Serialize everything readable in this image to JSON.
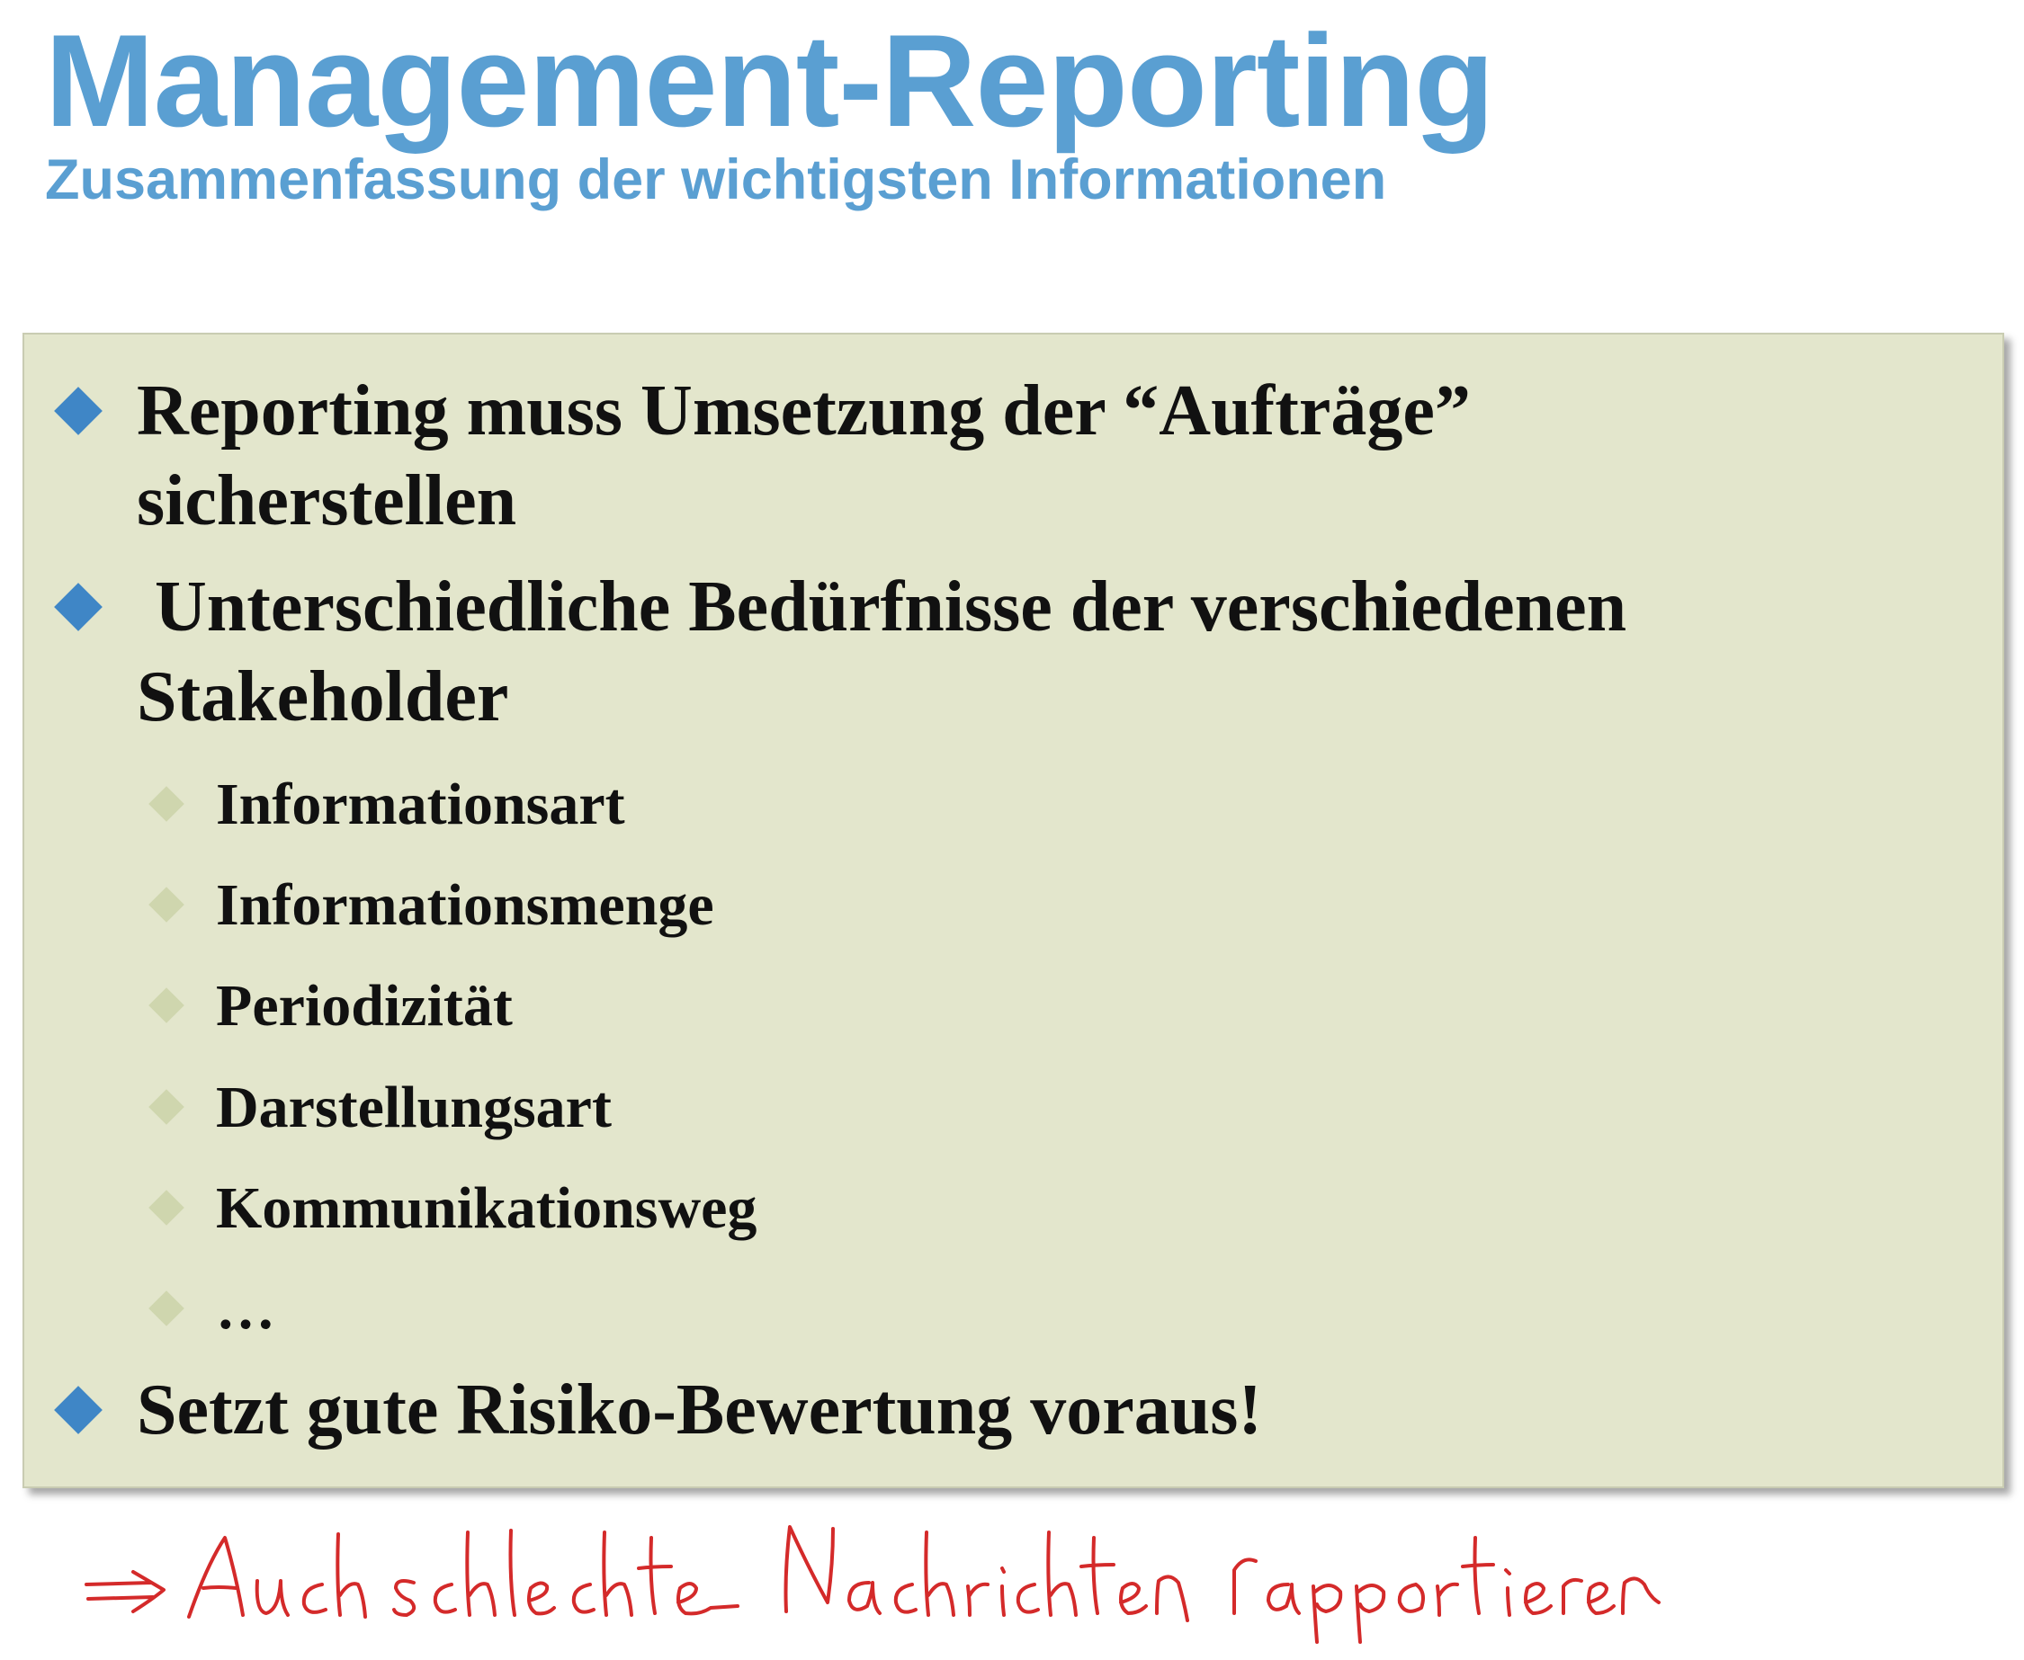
{
  "slide": {
    "title": "Management-Reporting",
    "subtitle": "Zusammenfassung der wichtigsten Informationen"
  },
  "bullets": {
    "b1_line1": "Reporting muss Umsetzung der “Aufträge”",
    "b1_line2": "sicherstellen",
    "b2_line1": " Unterschiedliche Bedürfnisse der verschiedenen",
    "b2_line2": "Stakeholder",
    "sub": [
      "Informationsart",
      "Informationsmenge",
      "Periodizität",
      "Darstellungsart",
      "Kommunikationsweg",
      "…"
    ],
    "b3": "Setzt gute Risiko-Bewertung voraus!"
  },
  "annotation": {
    "handwritten": "⇒ Auch schlechte Nachrichten rapportieren"
  },
  "colors": {
    "title": "#5a9fd2",
    "box_background": "#e3e6cc",
    "bullet_level1": "#3f86c6",
    "bullet_level2": "#cfd6ae",
    "handwriting": "#d42a2a"
  }
}
